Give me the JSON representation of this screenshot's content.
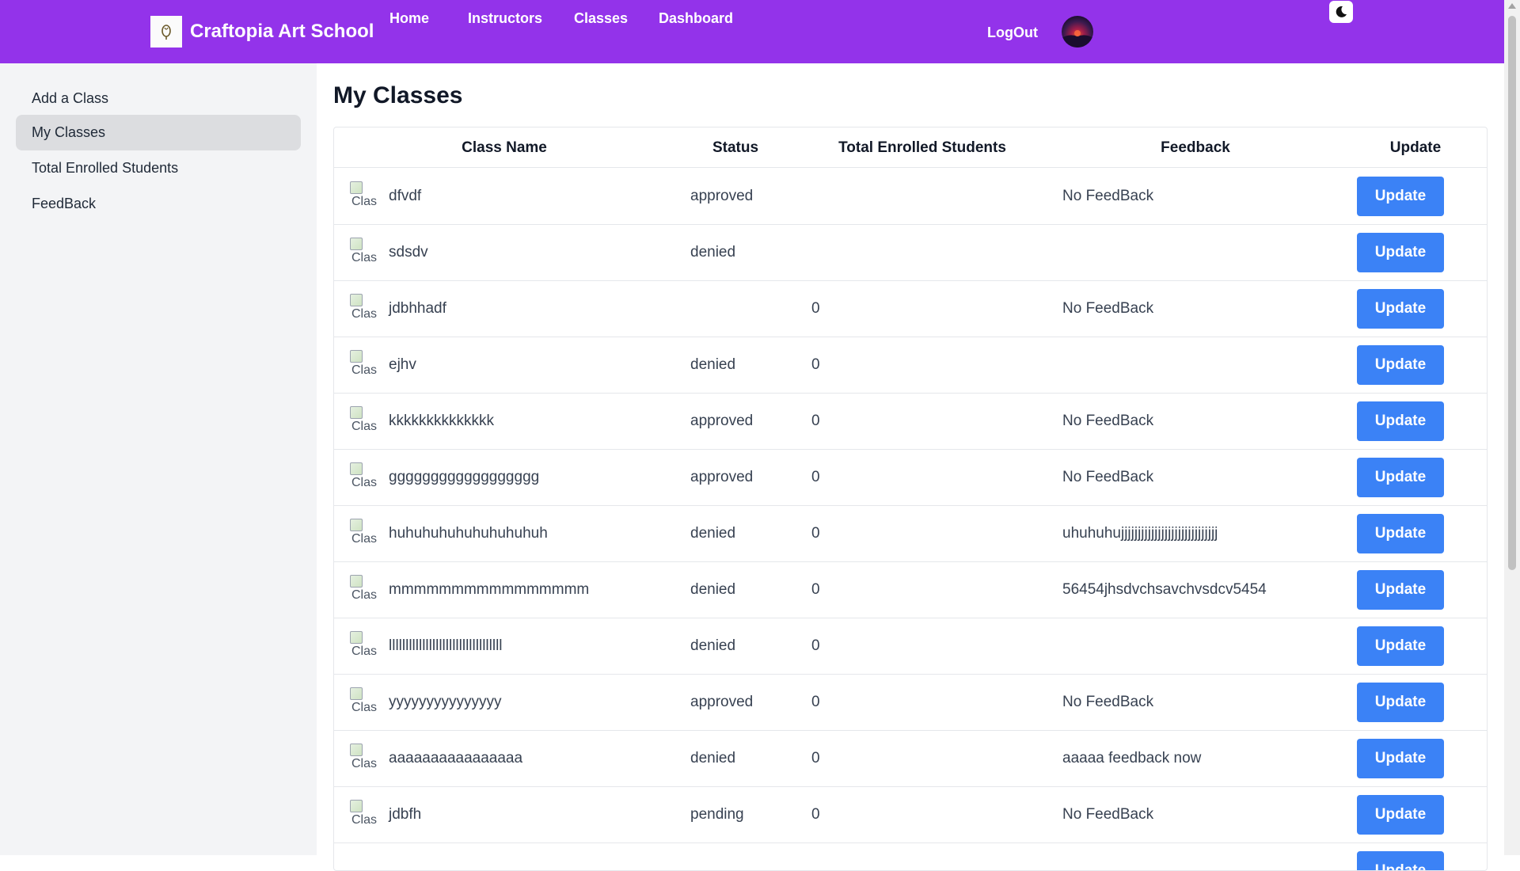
{
  "header": {
    "brand": "Craftopia Art School",
    "nav": [
      {
        "label": "Home"
      },
      {
        "label": "Instructors"
      },
      {
        "label": "Classes"
      },
      {
        "label": "Dashboard"
      }
    ],
    "logout_label": "LogOut",
    "theme_icon": "moon-icon",
    "accent_color": "#9333ea"
  },
  "sidebar": {
    "items": [
      {
        "label": "Add a Class"
      },
      {
        "label": "My Classes",
        "active": true
      },
      {
        "label": "Total Enrolled Students"
      },
      {
        "label": "FeedBack"
      }
    ]
  },
  "main": {
    "title": "My Classes",
    "table": {
      "headers": [
        "Class Name",
        "Status",
        "Total Enrolled Students",
        "Feedback",
        "Update"
      ],
      "image_alt": "Clas",
      "rows": [
        {
          "name": "dfvdf",
          "status": "approved",
          "enrolled": "",
          "feedback": "No FeedBack",
          "button": "Update"
        },
        {
          "name": "sdsdv",
          "status": "denied",
          "enrolled": "",
          "feedback": "",
          "button": "Update"
        },
        {
          "name": "jdbhhadf",
          "status": "",
          "enrolled": "0",
          "feedback": "No FeedBack",
          "button": "Update"
        },
        {
          "name": "ejhv",
          "status": "denied",
          "enrolled": "0",
          "feedback": "",
          "button": "Update"
        },
        {
          "name": "kkkkkkkkkkkkkk",
          "status": "approved",
          "enrolled": "0",
          "feedback": "No FeedBack",
          "button": "Update"
        },
        {
          "name": "gggggggggggggggggg",
          "status": "approved",
          "enrolled": "0",
          "feedback": "No FeedBack",
          "button": "Update"
        },
        {
          "name": "huhuhuhuhuhuhuhuhuh",
          "status": "denied",
          "enrolled": "0",
          "feedback": "uhuhuhujjjjjjjjjjjjjjjjjjjjjjjjjjjjj",
          "button": "Update"
        },
        {
          "name": "mmmmmmmmmmmmmmmm",
          "status": "denied",
          "enrolled": "0",
          "feedback": "56454jhsdvchsavchvsdcv5454",
          "button": "Update"
        },
        {
          "name": "llllllllllllllllllllllllllllllllll",
          "status": "denied",
          "enrolled": "0",
          "feedback": "",
          "button": "Update"
        },
        {
          "name": "yyyyyyyyyyyyyyy",
          "status": "approved",
          "enrolled": "0",
          "feedback": "No FeedBack",
          "button": "Update"
        },
        {
          "name": "aaaaaaaaaaaaaaaa",
          "status": "denied",
          "enrolled": "0",
          "feedback": "aaaaa feedback now",
          "button": "Update"
        },
        {
          "name": "jdbfh",
          "status": "pending",
          "enrolled": "0",
          "feedback": "No FeedBack",
          "button": "Update"
        },
        {
          "name": "",
          "status": "",
          "enrolled": "",
          "feedback": "",
          "button": "Update"
        }
      ]
    },
    "button_color": "#3b82f6"
  }
}
